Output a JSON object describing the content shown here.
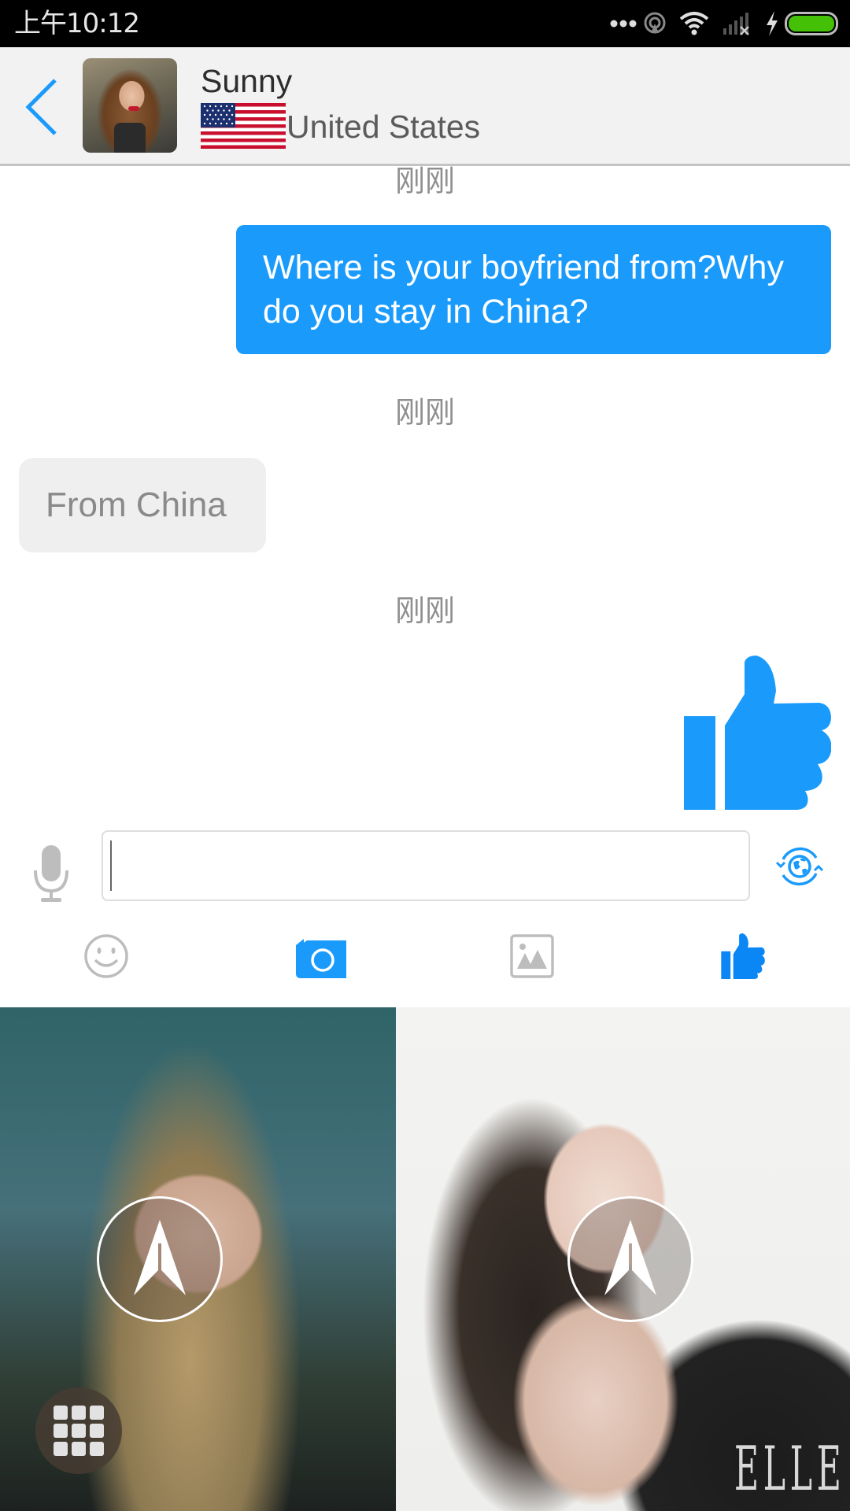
{
  "status_bar": {
    "time": "上午10:12",
    "icons": [
      "more-dots-icon",
      "hotspot-icon",
      "wifi-icon",
      "signal-no-service-icon",
      "charging-bolt-icon",
      "battery-icon"
    ],
    "battery_color": "#44c106"
  },
  "header": {
    "back_icon": "chevron-left-icon",
    "contact_name": "Sunny",
    "country_flag": "us-flag",
    "country": "United States"
  },
  "messages": [
    {
      "type": "timestamp",
      "text": "刚刚"
    },
    {
      "type": "outgoing",
      "text": "Where is your boyfriend from?Why do you stay in China?"
    },
    {
      "type": "timestamp",
      "text": "刚刚"
    },
    {
      "type": "incoming",
      "text": "From China"
    },
    {
      "type": "timestamp",
      "text": "刚刚"
    },
    {
      "type": "outgoing-sticker",
      "icon": "thumbs-up-icon"
    }
  ],
  "composer": {
    "value": "",
    "placeholder": "",
    "mic_icon": "microphone-icon",
    "translate_icon": "globe-translate-icon"
  },
  "toolbar": [
    {
      "icon": "emoji-icon",
      "active": false
    },
    {
      "icon": "camera-icon",
      "active": true
    },
    {
      "icon": "image-gallery-icon",
      "active": false
    },
    {
      "icon": "thumbs-up-icon",
      "active": true
    }
  ],
  "gallery": {
    "photos": [
      {
        "name": "photo-1",
        "action_icon": "send-arrow-icon"
      },
      {
        "name": "photo-2",
        "action_icon": "send-arrow-icon",
        "watermark": "ELLE"
      }
    ],
    "menu_icon": "grid-menu-icon"
  },
  "colors": {
    "accent": "#1a9bfc",
    "icon_inactive": "#bdbdbd",
    "header_bg": "#f2f2f2",
    "incoming_bubble": "#efefef",
    "timestamp": "#8f8f8f"
  }
}
